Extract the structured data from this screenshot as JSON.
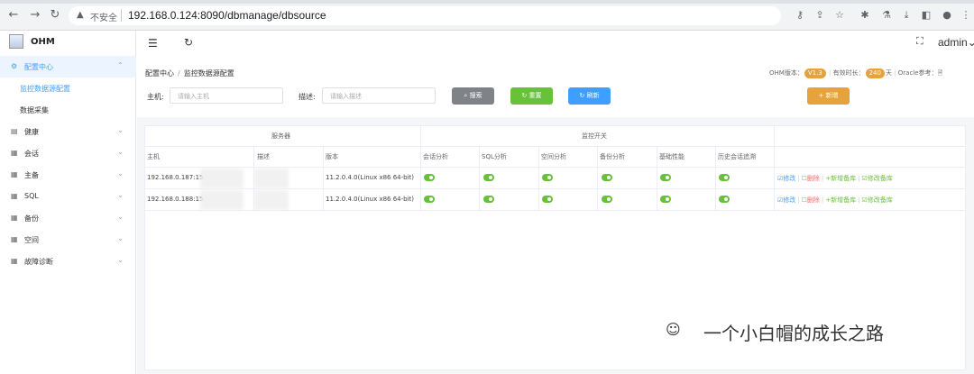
{
  "browser": {
    "url": "192.168.0.124:8090/dbmanage/dbsource",
    "insecure_label": "不安全",
    "back_icon": "arrow-left-icon",
    "forward_icon": "arrow-right-icon",
    "reload_icon": "reload-icon"
  },
  "app": {
    "logo_text": "OHM"
  },
  "sidebar": {
    "items": [
      {
        "label": "配置中心",
        "icon": "gear-icon",
        "arrow": "⌃",
        "active": true
      },
      {
        "label": "健康",
        "icon": "chart-icon",
        "arrow": "⌄"
      },
      {
        "label": "会话",
        "icon": "grid-icon",
        "arrow": "⌄"
      },
      {
        "label": "主备",
        "icon": "grid-icon",
        "arrow": "⌄"
      },
      {
        "label": "SQL",
        "icon": "grid-icon",
        "arrow": "⌄"
      },
      {
        "label": "备份",
        "icon": "grid-icon",
        "arrow": "⌄"
      },
      {
        "label": "空间",
        "icon": "grid-icon",
        "arrow": "⌄"
      },
      {
        "label": "故障诊断",
        "icon": "grid-icon",
        "arrow": "⌄"
      }
    ],
    "sub_items": [
      {
        "label": "监控数据源配置",
        "active": true
      },
      {
        "label": "数据采集"
      }
    ]
  },
  "header": {
    "user": "admin"
  },
  "breadcrumb": {
    "parent": "配置中心",
    "current": "监控数据源配置"
  },
  "info": {
    "version_label": "OHM版本：",
    "version": "V1.3",
    "valid_label": "有效时长：",
    "valid_days": "240",
    "days_unit": "天",
    "oracle_ref": "Oracle参考："
  },
  "filter": {
    "host_label": "主机:",
    "host_placeholder": "请输入主机",
    "desc_label": "描述:",
    "desc_placeholder": "请输入描述",
    "search": "搜索",
    "reset": "重置",
    "refresh": "刷新",
    "add": "+ 新增"
  },
  "colors": {
    "primary": "#409eff",
    "success": "#67c23a",
    "warning": "#e6a23c",
    "danger": "#f56c6c",
    "grey_btn": "#7f8388"
  },
  "table": {
    "group_headers": [
      "服务器",
      "监控开关"
    ],
    "columns": [
      "主机",
      "描述",
      "版本",
      "会话分析",
      "SQL分析",
      "空间分析",
      "备份分析",
      "基础性能",
      "历史会话追溯"
    ],
    "rows": [
      {
        "host": "192.168.0.187:15",
        "desc": "",
        "version": "11.2.0.4.0(Linux x86 64-bit)"
      },
      {
        "host": "192.168.0.188:15",
        "desc": "",
        "version": "11.2.0.4.0(Linux x86 64-bit)"
      }
    ],
    "actions": {
      "edit": "☑修改",
      "delete": "☐删除",
      "add_standby": "+新增备库",
      "edit_standby": "☑修改备库"
    }
  },
  "watermark": "一个小白帽的成长之路"
}
